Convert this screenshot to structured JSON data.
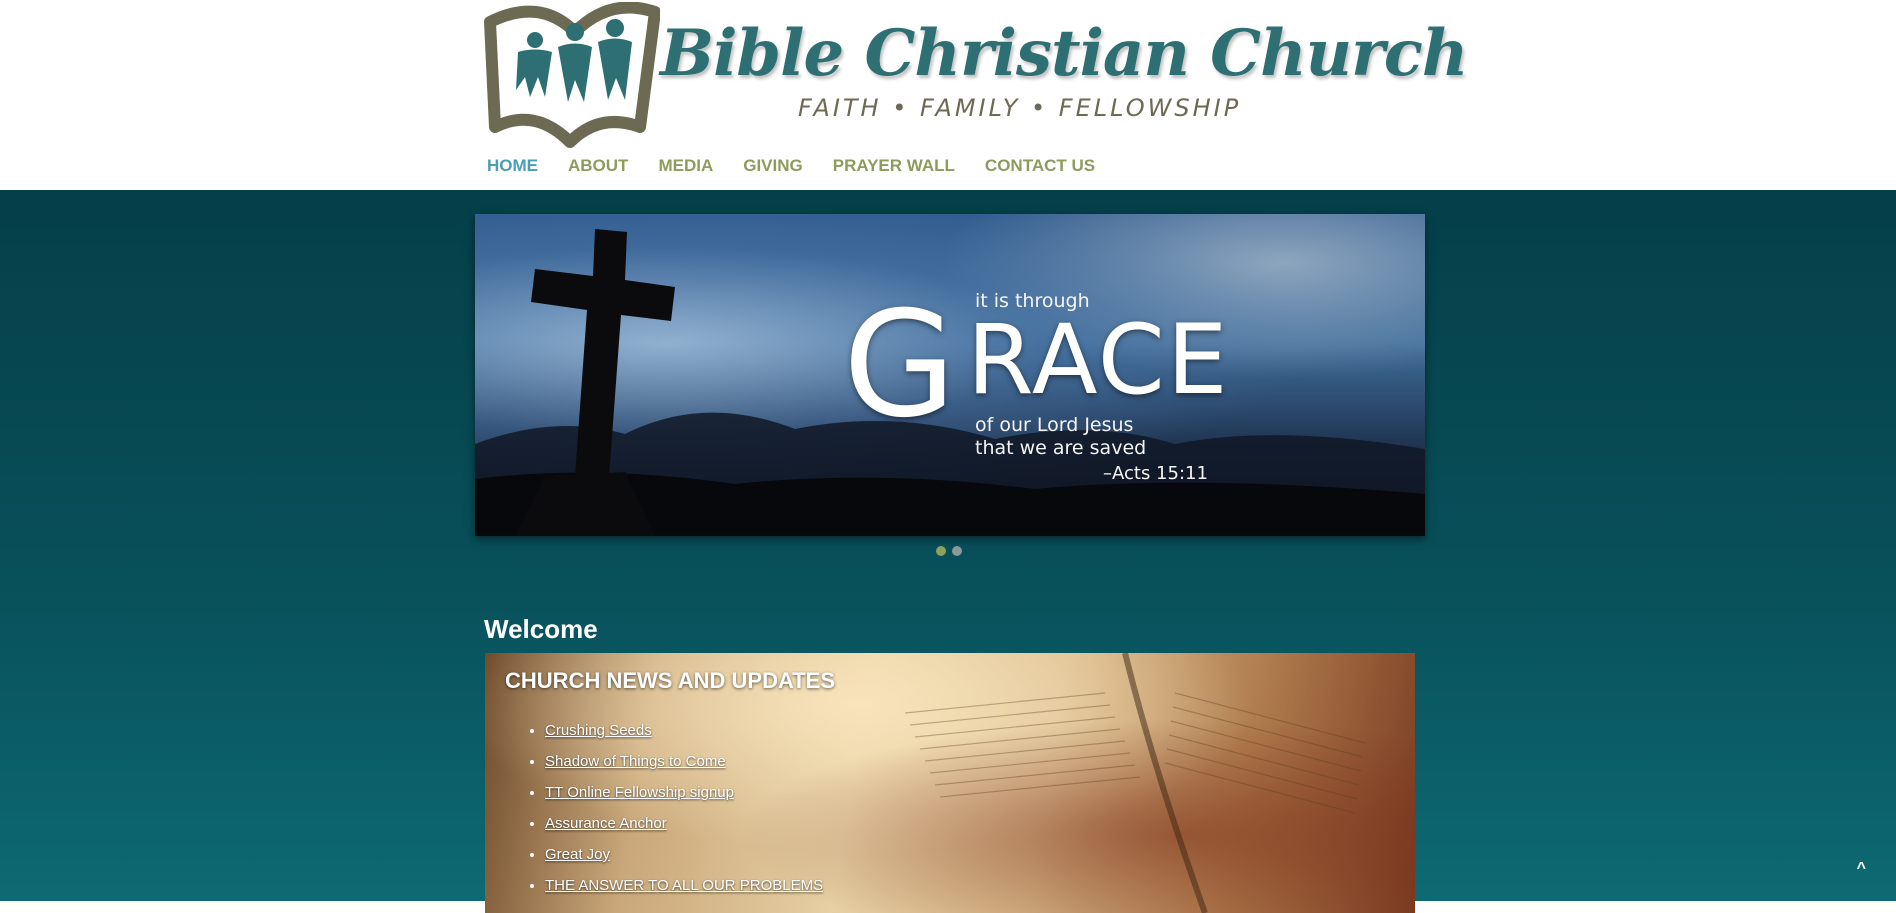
{
  "site": {
    "title": "Bible Christian Church",
    "tagline": "FAITH • FAMILY • FELLOWSHIP"
  },
  "nav": {
    "items": [
      {
        "label": "HOME",
        "active": true
      },
      {
        "label": "ABOUT"
      },
      {
        "label": "MEDIA"
      },
      {
        "label": "GIVING"
      },
      {
        "label": "PRAYER WALL"
      },
      {
        "label": "CONTACT US"
      }
    ]
  },
  "banner": {
    "line1": "it is through",
    "word_first": "G",
    "word_rest": "RACE",
    "line2": "of our Lord Jesus",
    "line3": "that we are saved",
    "reference": "–Acts 15:11",
    "slide_count": 2,
    "active_slide": 1
  },
  "welcome": {
    "heading": "Welcome"
  },
  "news": {
    "title": "CHURCH NEWS AND UPDATES",
    "items": [
      "Crushing Seeds",
      "Shadow of Things to Come",
      "TT Online Fellowship signup",
      "Assurance Anchor",
      "Great Joy",
      "THE ANSWER TO ALL OUR PROBLEMS"
    ]
  },
  "back_to_top": "^",
  "colors": {
    "nav_active": "#4a9eb3",
    "nav_default": "#8d9b5c",
    "logo_title": "#2d6f72",
    "background_main": "#053f49"
  }
}
